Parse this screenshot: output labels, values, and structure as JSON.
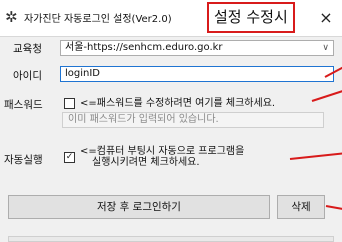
{
  "window": {
    "icon": "gear-icon",
    "title": "자가진단 자동로그인 설정(Ver2.0)",
    "overlay_caption": "설정 수정시",
    "close_symbol": "×"
  },
  "form": {
    "office": {
      "label": "교육청",
      "value": "서울-https://senhcm.eduro.go.kr",
      "dropdown_symbol": "∨"
    },
    "id": {
      "label": "아이디",
      "value": "loginID"
    },
    "password": {
      "label": "패스워드",
      "checkbox_text": "<=패스워드를 수정하려면 여기를 체크하세요.",
      "hint": "이미 패스워드가 입력되어 있습니다.",
      "checked": false
    },
    "autorun": {
      "label": "자동실행",
      "checkbox_text_line1": "<=컴퓨터 부팅시 자동으로 프로그램을",
      "checkbox_text_line2": "실행시키려면 체크하세요.",
      "checked": true,
      "check_mark": "✓"
    }
  },
  "buttons": {
    "save_login": "저장 후 로그인하기",
    "delete": "삭제"
  },
  "colors": {
    "annotation_red": "#d81b1b",
    "focus_blue": "#1f74d2"
  }
}
